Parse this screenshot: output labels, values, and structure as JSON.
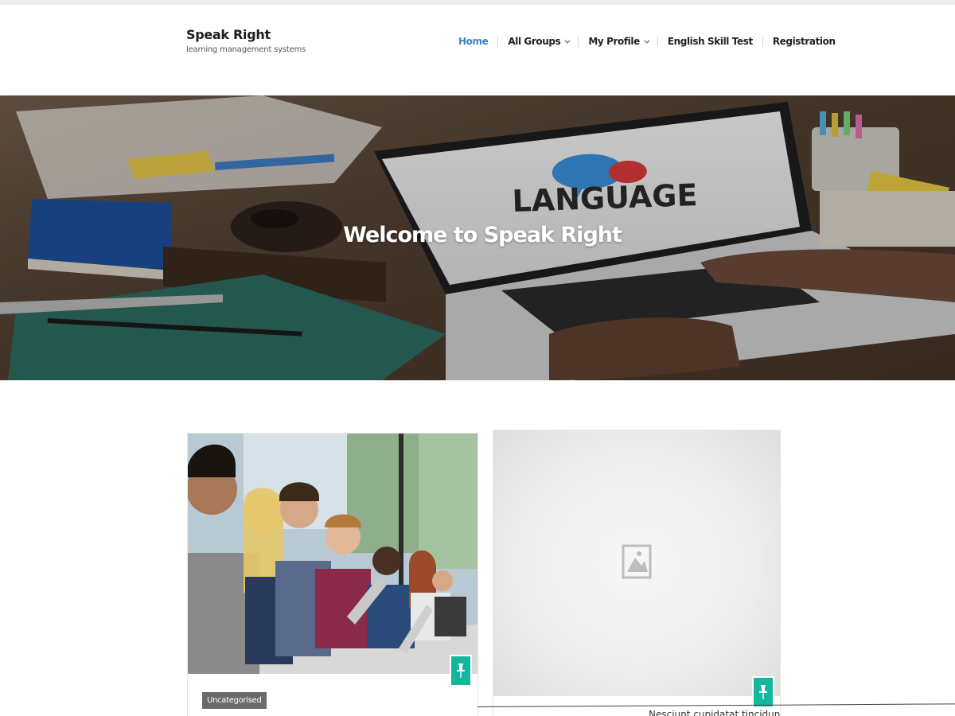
{
  "site": {
    "title": "Speak Right",
    "tagline": "learning management systems"
  },
  "nav": {
    "items": [
      {
        "label": "Home",
        "active": true,
        "has_dropdown": false
      },
      {
        "label": "All Groups",
        "active": false,
        "has_dropdown": true
      },
      {
        "label": "My Profile",
        "active": false,
        "has_dropdown": true
      },
      {
        "label": "English Skill Test",
        "active": false,
        "has_dropdown": false
      },
      {
        "label": "Registration",
        "active": false,
        "has_dropdown": false
      }
    ]
  },
  "hero": {
    "title": "Welcome to Speak Right",
    "image_text": "LANGUAGE"
  },
  "cards": [
    {
      "category": "Uncategorised",
      "excerpt": "...",
      "pinned": true,
      "image": "classroom-students-photo"
    },
    {
      "excerpt": "Nesciunt cupidatat tincidunt? Enim",
      "pinned": true,
      "image": "placeholder-image-icon"
    }
  ],
  "colors": {
    "accent": "#3b7fd0",
    "pin_badge": "#13b79b",
    "category_badge": "#6a6a6a"
  }
}
